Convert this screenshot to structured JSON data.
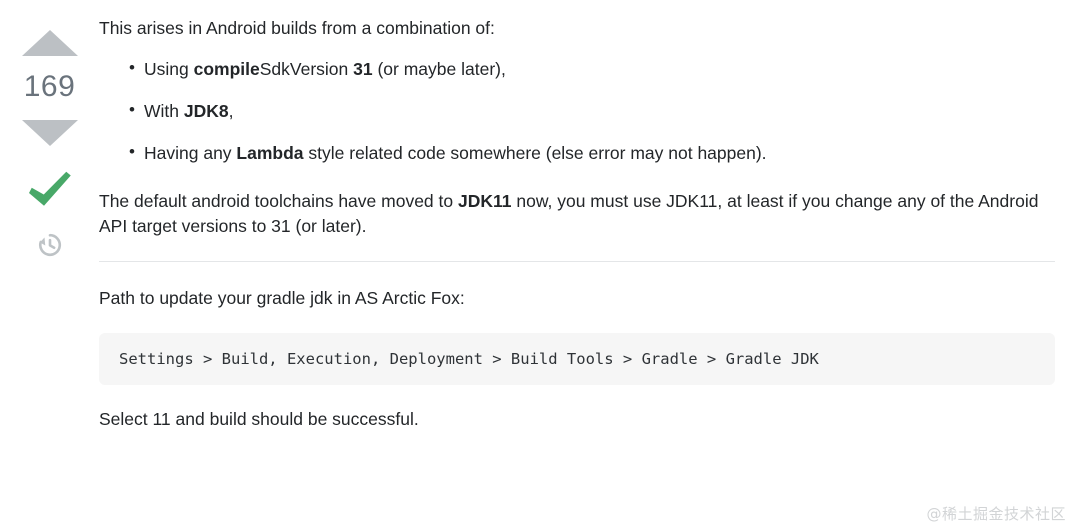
{
  "vote": {
    "count": "169",
    "upvote_label": "Up vote",
    "downvote_label": "Down vote",
    "accepted_label": "Accepted answer",
    "history_label": "Revision history",
    "arrow_color": "#bcc0c4",
    "count_color": "#6a737c",
    "accepted_color": "#48a868",
    "history_color": "#bbc0c4"
  },
  "content": {
    "intro": "This arises in Android builds from a combination of:",
    "bullets": [
      {
        "parts": [
          {
            "text": "Using ",
            "bold": false
          },
          {
            "text": "compile",
            "bold": true
          },
          {
            "text": "SdkVersion ",
            "bold": false
          },
          {
            "text": "31",
            "bold": true
          },
          {
            "text": " (or maybe later),",
            "bold": false
          }
        ]
      },
      {
        "parts": [
          {
            "text": "With ",
            "bold": false
          },
          {
            "text": "JDK8",
            "bold": true
          },
          {
            "text": ",",
            "bold": false
          }
        ]
      },
      {
        "parts": [
          {
            "text": "Having any ",
            "bold": false
          },
          {
            "text": "Lambda",
            "bold": true
          },
          {
            "text": " style related code somewhere (else error may not happen).",
            "bold": false
          }
        ]
      }
    ],
    "toolchain_paragraph": {
      "parts": [
        {
          "text": "The default android toolchains have moved to ",
          "bold": false
        },
        {
          "text": "JDK11",
          "bold": true
        },
        {
          "text": " now, you must use JDK11, at least if you change any of the Android API target versions to 31 (or later).",
          "bold": false
        }
      ]
    },
    "path_intro": "Path to update your gradle jdk in AS Arctic Fox:",
    "code_block": "Settings > Build, Execution, Deployment > Build Tools > Gradle > Gradle JDK",
    "closing": "Select 11 and build should be successful."
  },
  "watermark": {
    "text": "@稀土掘金技术社区",
    "color": "#d2d4d6"
  }
}
